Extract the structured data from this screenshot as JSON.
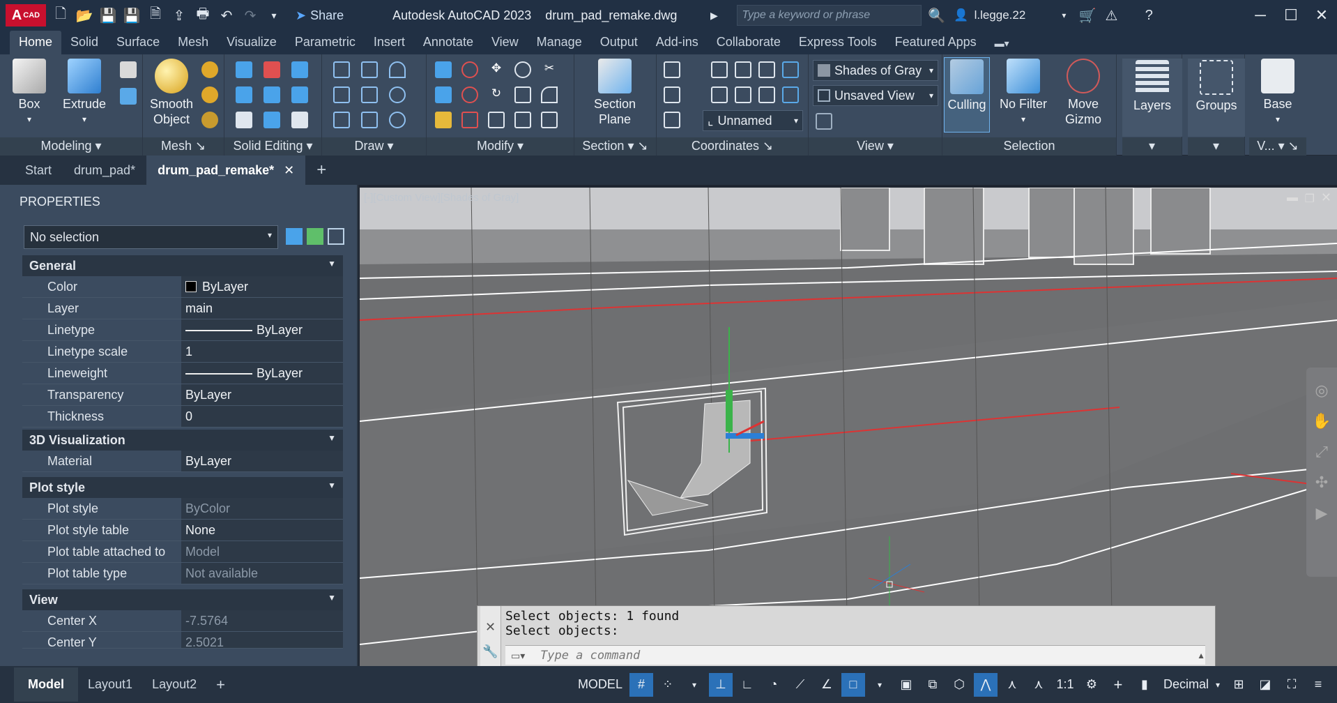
{
  "app": {
    "logo_text": "A",
    "logo_sub": "CAD",
    "share": "Share",
    "title": "Autodesk AutoCAD 2023",
    "filename": "drum_pad_remake.dwg",
    "search_placeholder": "Type a keyword or phrase",
    "user": "l.legge.22"
  },
  "ribbon_tabs": [
    "Home",
    "Solid",
    "Surface",
    "Mesh",
    "Visualize",
    "Parametric",
    "Insert",
    "Annotate",
    "View",
    "Manage",
    "Output",
    "Add-ins",
    "Collaborate",
    "Express Tools",
    "Featured Apps"
  ],
  "ribbon": {
    "box": "Box",
    "extrude": "Extrude",
    "smooth": "Smooth Object",
    "section_plane": "Section Plane",
    "visual_style": "Shades of Gray",
    "saved_view": "Unsaved View",
    "ucs": "Unnamed",
    "culling": "Culling",
    "no_filter": "No Filter",
    "move_gizmo": "Move Gizmo",
    "layers": "Layers",
    "groups": "Groups",
    "base": "Base",
    "panels": {
      "modeling": "Modeling",
      "mesh": "Mesh",
      "solid_editing": "Solid Editing",
      "draw": "Draw",
      "modify": "Modify",
      "section": "Section",
      "coordinates": "Coordinates",
      "view": "View",
      "selection": "Selection",
      "view2": "V..."
    }
  },
  "doc_tabs": {
    "start": "Start",
    "tab1": "drum_pad*",
    "tab2": "drum_pad_remake*"
  },
  "properties": {
    "title": "PROPERTIES",
    "selection": "No selection",
    "general": "General",
    "viz3d": "3D Visualization",
    "plot_style_sect": "Plot style",
    "view_sect": "View",
    "rows": {
      "color": [
        "Color",
        "ByLayer"
      ],
      "layer": [
        "Layer",
        "main"
      ],
      "linetype": [
        "Linetype",
        "ByLayer"
      ],
      "ltscale": [
        "Linetype scale",
        "1"
      ],
      "lineweight": [
        "Lineweight",
        "ByLayer"
      ],
      "transparency": [
        "Transparency",
        "ByLayer"
      ],
      "thickness": [
        "Thickness",
        "0"
      ],
      "material": [
        "Material",
        "ByLayer"
      ],
      "plotstyle": [
        "Plot style",
        "ByColor"
      ],
      "plottable": [
        "Plot style table",
        "None"
      ],
      "attached": [
        "Plot table attached to",
        "Model"
      ],
      "ptype": [
        "Plot table type",
        "Not available"
      ],
      "cx": [
        "Center X",
        "-7.5764"
      ],
      "cy": [
        "Center Y",
        "2.5021"
      ]
    }
  },
  "viewport": {
    "label": "[-][Custom View][Shades of Gray]"
  },
  "command": {
    "line1": "Select objects: 1 found",
    "line2": "Select objects:",
    "placeholder": "Type a command"
  },
  "status": {
    "model": "Model",
    "layout1": "Layout1",
    "layout2": "Layout2",
    "model_btn": "MODEL",
    "scale": "1:1",
    "units": "Decimal"
  }
}
